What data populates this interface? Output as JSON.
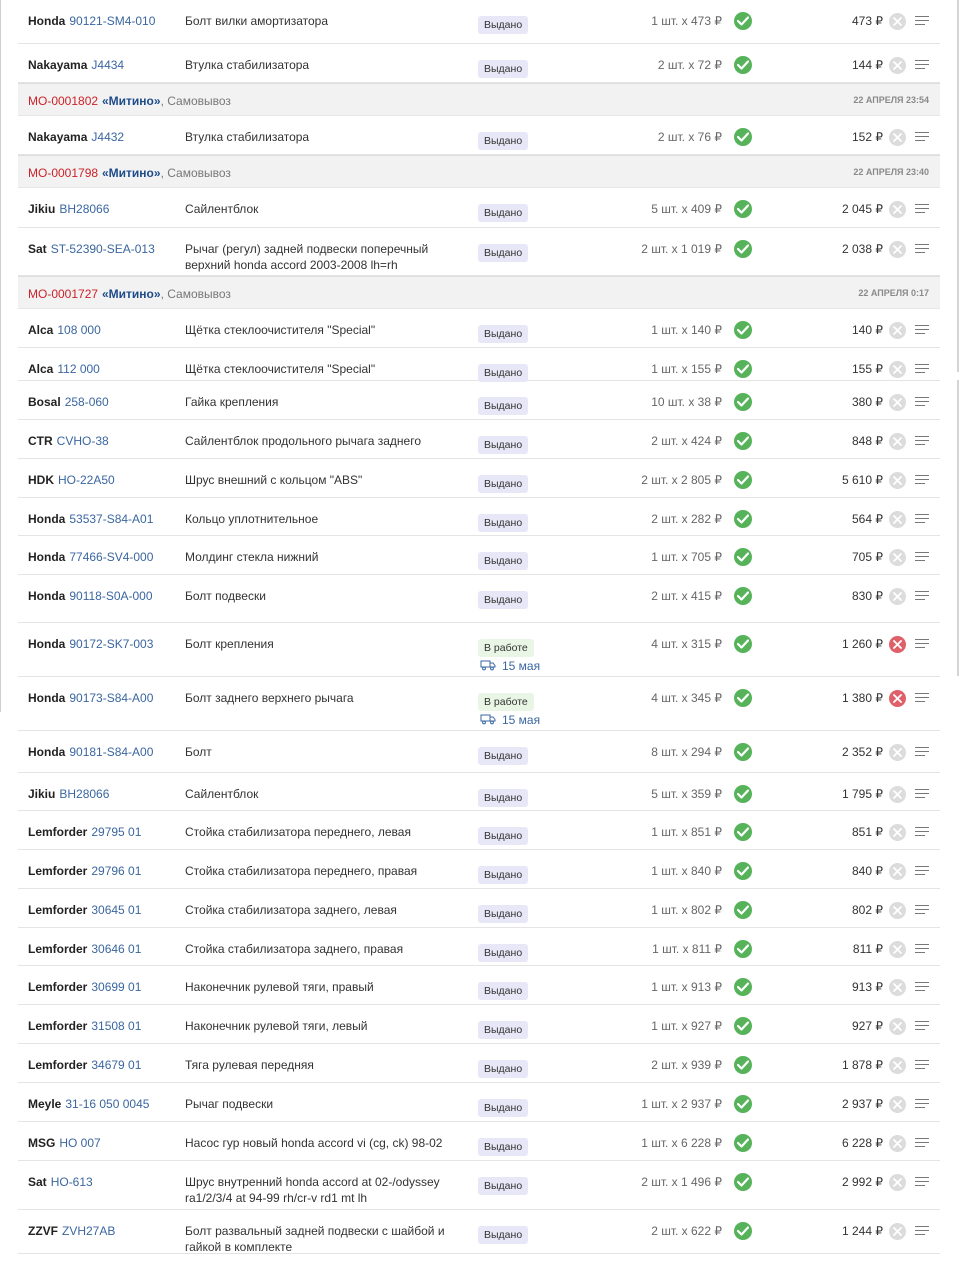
{
  "currency": "₽",
  "groups": [
    {
      "order": "",
      "pickup_point": "",
      "method": "",
      "datetime": "",
      "items": [
        {
          "brand": "Honda",
          "code": "90121-SM4-010",
          "name": "Болт вилки амортизатора",
          "status": "Выдано",
          "qty": "1 шт. x 473 ₽",
          "sum": "473 ₽",
          "cancelable": false,
          "delivery": ""
        },
        {
          "brand": "Nakayama",
          "code": "J4434",
          "name": "Втулка стабилизатора",
          "status": "Выдано",
          "qty": "2 шт. x 72 ₽",
          "sum": "144 ₽",
          "cancelable": false,
          "delivery": ""
        }
      ]
    },
    {
      "order": "МО-0001802",
      "pickup_point": "«Митино»",
      "method": ", Самовывоз",
      "datetime": "22 АПРЕЛЯ 23:54",
      "items": [
        {
          "brand": "Nakayama",
          "code": "J4432",
          "name": "Втулка стабилизатора",
          "status": "Выдано",
          "qty": "2 шт. x 76 ₽",
          "sum": "152 ₽",
          "cancelable": false,
          "delivery": ""
        }
      ]
    },
    {
      "order": "МО-0001798",
      "pickup_point": "«Митино»",
      "method": ", Самовывоз",
      "datetime": "22 АПРЕЛЯ 23:40",
      "items": [
        {
          "brand": "Jikiu",
          "code": "BH28066",
          "name": "Сайлентблок",
          "status": "Выдано",
          "qty": "5 шт. x 409 ₽",
          "sum": "2 045 ₽",
          "cancelable": false,
          "delivery": ""
        },
        {
          "brand": "Sat",
          "code": "ST-52390-SEA-013",
          "name": "Рычаг (регул) задней подвески поперечный верхний honda accord 2003-2008 lh=rh",
          "status": "Выдано",
          "qty": "2 шт. x 1 019 ₽",
          "sum": "2 038 ₽",
          "cancelable": false,
          "delivery": ""
        }
      ]
    },
    {
      "order": "МО-0001727",
      "pickup_point": "«Митино»",
      "method": ", Самовывоз",
      "datetime": "22 АПРЕЛЯ 0:17",
      "items": [
        {
          "brand": "Alca",
          "code": "108 000",
          "name": "Щётка стеклоочистителя \"Special\"",
          "status": "Выдано",
          "qty": "1 шт. x 140 ₽",
          "sum": "140 ₽",
          "cancelable": false,
          "delivery": ""
        },
        {
          "brand": "Alca",
          "code": "112 000",
          "name": "Щётка стеклоочистителя \"Special\"",
          "status": "Выдано",
          "qty": "1 шт. x 155 ₽",
          "sum": "155 ₽",
          "cancelable": false,
          "delivery": ""
        },
        {
          "brand": "Bosal",
          "code": "258-060",
          "name": "Гайка крепления",
          "status": "Выдано",
          "qty": "10 шт. x 38 ₽",
          "sum": "380 ₽",
          "cancelable": false,
          "delivery": ""
        },
        {
          "brand": "CTR",
          "code": "CVHO-38",
          "name": "Сайлентблок продольного рычага заднего",
          "status": "Выдано",
          "qty": "2 шт. x 424 ₽",
          "sum": "848 ₽",
          "cancelable": false,
          "delivery": ""
        },
        {
          "brand": "HDK",
          "code": "HO-22A50",
          "name": "Шрус внешний с кольцом \"ABS\"",
          "status": "Выдано",
          "qty": "2 шт. x 2 805 ₽",
          "sum": "5 610 ₽",
          "cancelable": false,
          "delivery": ""
        },
        {
          "brand": "Honda",
          "code": "53537-S84-A01",
          "name": "Кольцо уплотнительное",
          "status": "Выдано",
          "qty": "2 шт. x 282 ₽",
          "sum": "564 ₽",
          "cancelable": false,
          "delivery": ""
        },
        {
          "brand": "Honda",
          "code": "77466-SV4-000",
          "name": "Молдинг стекла нижний",
          "status": "Выдано",
          "qty": "1 шт. x 705 ₽",
          "sum": "705 ₽",
          "cancelable": false,
          "delivery": ""
        },
        {
          "brand": "Honda",
          "code": "90118-S0A-000",
          "name": "Болт подвески",
          "status": "Выдано",
          "qty": "2 шт. x 415 ₽",
          "sum": "830 ₽",
          "cancelable": false,
          "delivery": ""
        },
        {
          "brand": "Honda",
          "code": "90172-SK7-003",
          "name": "Болт крепления",
          "status": "В работе",
          "qty": "4 шт. x 315 ₽",
          "sum": "1 260 ₽",
          "cancelable": true,
          "delivery": "15 мая"
        },
        {
          "brand": "Honda",
          "code": "90173-S84-A00",
          "name": "Болт заднего верхнего рычага",
          "status": "В работе",
          "qty": "4 шт. x 345 ₽",
          "sum": "1 380 ₽",
          "cancelable": true,
          "delivery": "15 мая"
        },
        {
          "brand": "Honda",
          "code": "90181-S84-A00",
          "name": "Болт",
          "status": "Выдано",
          "qty": "8 шт. x 294 ₽",
          "sum": "2 352 ₽",
          "cancelable": false,
          "delivery": ""
        },
        {
          "brand": "Jikiu",
          "code": "BH28066",
          "name": "Сайлентблок",
          "status": "Выдано",
          "qty": "5 шт. x 359 ₽",
          "sum": "1 795 ₽",
          "cancelable": false,
          "delivery": ""
        },
        {
          "brand": "Lemforder",
          "code": "29795 01",
          "name": "Стойка стабилизатора переднего, левая",
          "status": "Выдано",
          "qty": "1 шт. x 851 ₽",
          "sum": "851 ₽",
          "cancelable": false,
          "delivery": ""
        },
        {
          "brand": "Lemforder",
          "code": "29796 01",
          "name": "Стойка стабилизатора переднего, правая",
          "status": "Выдано",
          "qty": "1 шт. x 840 ₽",
          "sum": "840 ₽",
          "cancelable": false,
          "delivery": ""
        },
        {
          "brand": "Lemforder",
          "code": "30645 01",
          "name": "Стойка стабилизатора заднего, левая",
          "status": "Выдано",
          "qty": "1 шт. x 802 ₽",
          "sum": "802 ₽",
          "cancelable": false,
          "delivery": ""
        },
        {
          "brand": "Lemforder",
          "code": "30646 01",
          "name": "Стойка стабилизатора заднего, правая",
          "status": "Выдано",
          "qty": "1 шт. x 811 ₽",
          "sum": "811 ₽",
          "cancelable": false,
          "delivery": ""
        },
        {
          "brand": "Lemforder",
          "code": "30699 01",
          "name": "Наконечник рулевой тяги, правый",
          "status": "Выдано",
          "qty": "1 шт. x 913 ₽",
          "sum": "913 ₽",
          "cancelable": false,
          "delivery": ""
        },
        {
          "brand": "Lemforder",
          "code": "31508 01",
          "name": "Наконечник рулевой тяги, левый",
          "status": "Выдано",
          "qty": "1 шт. x 927 ₽",
          "sum": "927 ₽",
          "cancelable": false,
          "delivery": ""
        },
        {
          "brand": "Lemforder",
          "code": "34679 01",
          "name": "Тяга рулевая передняя",
          "status": "Выдано",
          "qty": "2 шт. x 939 ₽",
          "sum": "1 878 ₽",
          "cancelable": false,
          "delivery": ""
        },
        {
          "brand": "Meyle",
          "code": "31-16 050 0045",
          "name": "Рычаг подвески",
          "status": "Выдано",
          "qty": "1 шт. x 2 937 ₽",
          "sum": "2 937 ₽",
          "cancelable": false,
          "delivery": ""
        },
        {
          "brand": "MSG",
          "code": "HO 007",
          "name": "Насос гур новый honda accord vi (cg, ck) 98-02",
          "status": "Выдано",
          "qty": "1 шт. x 6 228 ₽",
          "sum": "6 228 ₽",
          "cancelable": false,
          "delivery": ""
        },
        {
          "brand": "Sat",
          "code": "HO-613",
          "name": "Шрус внутренний honda accord at 02-/odyssey ra1/2/3/4 at 94-99 rh/cr-v rd1 mt lh",
          "status": "Выдано",
          "qty": "2 шт. x 1 496 ₽",
          "sum": "2 992 ₽",
          "cancelable": false,
          "delivery": ""
        },
        {
          "brand": "ZZVF",
          "code": "ZVH27AB",
          "name": "Болт развальный задней подвески с шайбой и гайкой в комплекте",
          "status": "Выдано",
          "qty": "2 шт. x 622 ₽",
          "sum": "1 244 ₽",
          "cancelable": false,
          "delivery": ""
        }
      ]
    }
  ]
}
